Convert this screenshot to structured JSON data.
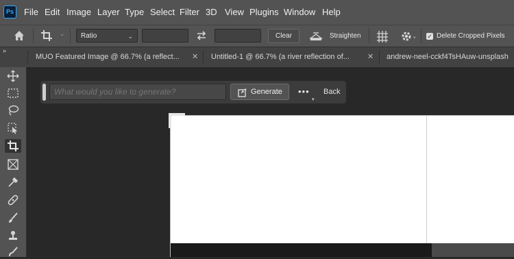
{
  "app": {
    "logo_text": "Ps"
  },
  "menu": [
    "File",
    "Edit",
    "Image",
    "Layer",
    "Type",
    "Select",
    "Filter",
    "3D",
    "View",
    "Plugins",
    "Window",
    "Help"
  ],
  "options_bar": {
    "ratio_label": "Ratio",
    "clear_label": "Clear",
    "straighten_label": "Straighten",
    "delete_cropped_label": "Delete Cropped Pixels",
    "delete_cropped_checked": true
  },
  "tabs": [
    {
      "label": "MUO Featured Image @ 66.7% (a reflect..."
    },
    {
      "label": "Untitled-1 @ 66.7% (a river reflection of..."
    },
    {
      "label": "andrew-neel-cckf4TsHAuw-unsplash"
    }
  ],
  "generate_bar": {
    "placeholder": "What would you like to generate?",
    "generate_label": "Generate",
    "more_label": "•••",
    "back_label": "Back"
  },
  "tools": [
    "move-tool",
    "marquee-tool",
    "lasso-tool",
    "object-select-tool",
    "crop-tool",
    "frame-tool",
    "eyedropper-tool",
    "healing-brush-tool",
    "brush-tool",
    "clone-stamp-tool",
    "history-brush-tool"
  ],
  "active_tool": "crop-tool"
}
